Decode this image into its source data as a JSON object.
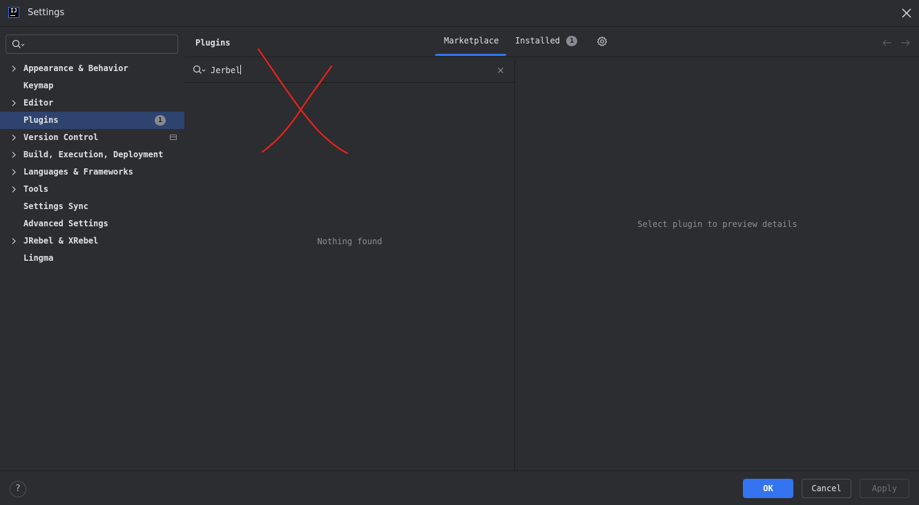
{
  "window": {
    "title": "Settings",
    "logo_text": "IJ"
  },
  "sidebar": {
    "search": {
      "value": "",
      "placeholder": ""
    },
    "items": [
      {
        "label": "Appearance & Behavior",
        "expandable": true
      },
      {
        "label": "Keymap",
        "expandable": false
      },
      {
        "label": "Editor",
        "expandable": true
      },
      {
        "label": "Plugins",
        "expandable": false,
        "selected": true,
        "badge": "1"
      },
      {
        "label": "Version Control",
        "expandable": true
      },
      {
        "label": "Build, Execution, Deployment",
        "expandable": true
      },
      {
        "label": "Languages & Frameworks",
        "expandable": true
      },
      {
        "label": "Tools",
        "expandable": true
      },
      {
        "label": "Settings Sync",
        "expandable": false
      },
      {
        "label": "Advanced Settings",
        "expandable": false
      },
      {
        "label": "JRebel & XRebel",
        "expandable": true
      },
      {
        "label": "Lingma",
        "expandable": false
      }
    ]
  },
  "main": {
    "title": "Plugins",
    "tabs": [
      {
        "label": "Marketplace",
        "active": true
      },
      {
        "label": "Installed",
        "badge": "1"
      }
    ],
    "plugin_search": {
      "value": "Jerbel"
    },
    "empty_list_text": "Nothing found",
    "detail_empty_text": "Select plugin to preview details"
  },
  "footer": {
    "help_label": "?",
    "ok_label": "OK",
    "cancel_label": "Cancel",
    "apply_label": "Apply"
  },
  "colors": {
    "background": "#2b2d30",
    "selection": "#2e436e",
    "accent": "#3574f0",
    "annotation": "#e8231a"
  }
}
